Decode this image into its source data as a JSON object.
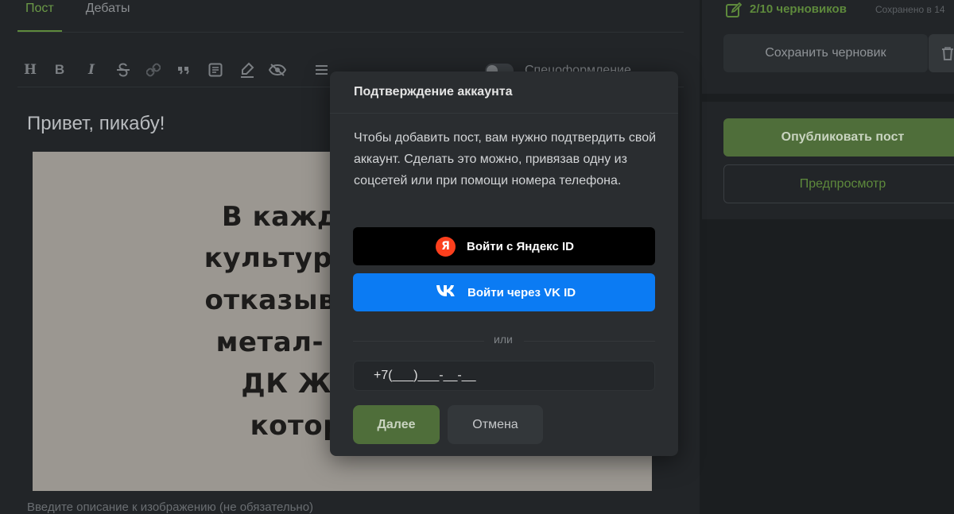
{
  "tabs": [
    {
      "label": "Пост"
    },
    {
      "label": "Дебаты"
    }
  ],
  "toolbar": {
    "heading_label": "H",
    "bold_label": "B",
    "italic_label": "I",
    "spoiler_label": "Спецоформление"
  },
  "editor": {
    "title": "Привет, пикабу!",
    "image_lines": [
      "В каждом горо",
      "культурные учре",
      "отказываются пр",
      "метал- и панк-к",
      "ДК Железно",
      "который не"
    ],
    "image_caption_placeholder": "Введите описание к изображению (не обязательно)"
  },
  "sidebar": {
    "drafts_count": "2/10 черновиков",
    "saved_at": "Сохранено в 14",
    "save_draft_label": "Сохранить черновик",
    "publish_label": "Опубликовать пост",
    "preview_label": "Предпросмотр"
  },
  "modal": {
    "title": "Подтверждение аккаунта",
    "body": "Чтобы добавить пост, вам нужно подтвердить свой аккаунт. Сделать это можно, привязав одну из соцсетей или при помощи номера телефона.",
    "yandex_label": "Войти с Яндекс ID",
    "yandex_icon_letter": "Я",
    "vk_label": "Войти через VK ID",
    "or_label": "или",
    "phone_value": "+7(___)___-__-__",
    "next_label": "Далее",
    "cancel_label": "Отмена"
  },
  "colors": {
    "accent_green": "#5e8a3c",
    "vk_blue": "#0b7bf3",
    "yandex_red": "#fc3f1d"
  }
}
